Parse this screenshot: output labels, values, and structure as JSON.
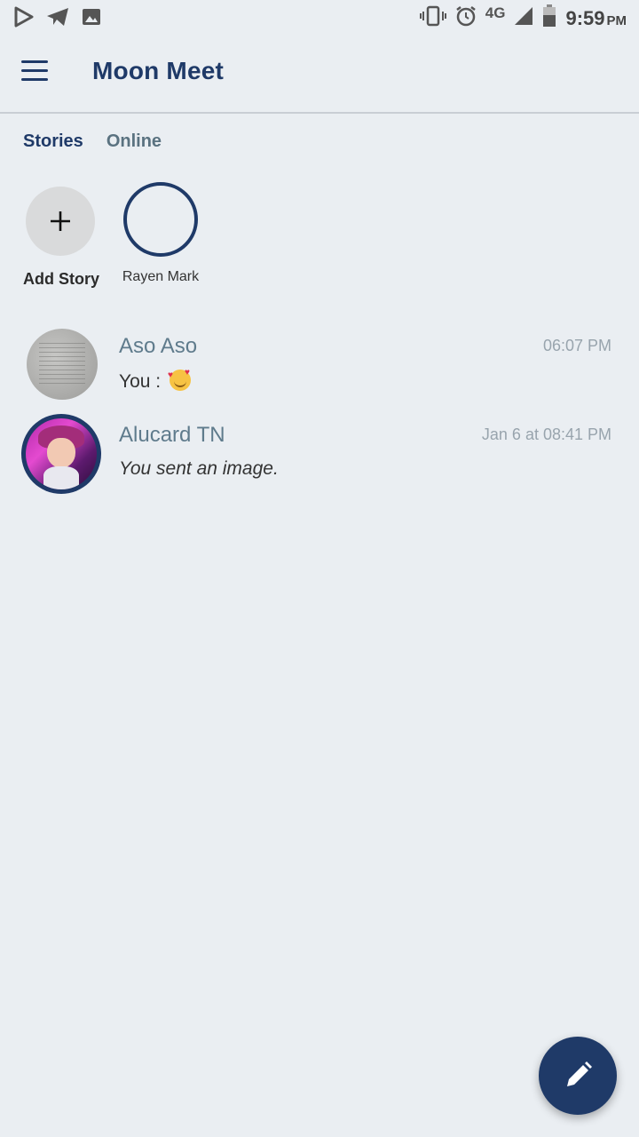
{
  "status_bar": {
    "network": "4G",
    "time": "9:59",
    "ampm": "PM",
    "icons_left": [
      "play-store-icon",
      "telegram-icon",
      "image-icon"
    ],
    "icons_right": [
      "vibrate-icon",
      "alarm-icon",
      "signal-icon",
      "battery-icon"
    ]
  },
  "app_bar": {
    "title": "Moon Meet",
    "menu_icon": "hamburger-menu-icon"
  },
  "tabs": [
    {
      "label": "Stories",
      "active": true
    },
    {
      "label": "Online",
      "active": false
    }
  ],
  "stories": [
    {
      "label": "Add Story",
      "icon": "plus-icon"
    },
    {
      "label": "Rayen Mark"
    }
  ],
  "chats": [
    {
      "name": "Aso Aso",
      "time": "06:07 PM",
      "message": "You :",
      "emoji": "smiling-face-with-hearts"
    },
    {
      "name": "Alucard TN",
      "time": "Jan 6 at 08:41 PM",
      "message": "You sent an image."
    }
  ],
  "fab": {
    "icon": "pencil-icon"
  },
  "colors": {
    "background": "#eaeef2",
    "primary": "#1f3a68",
    "name_text": "#5f7b8c",
    "time_text": "#98a4ad"
  }
}
